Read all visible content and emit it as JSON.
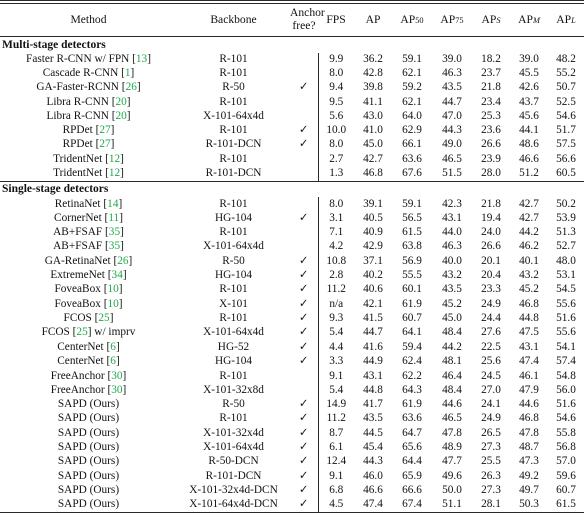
{
  "table": {
    "columns": [
      {
        "key": "method",
        "label": "Method"
      },
      {
        "key": "backbone",
        "label": "Backbone"
      },
      {
        "key": "anchor",
        "label": "Anchor free?",
        "label_line1": "Anchor",
        "label_line2": "free?"
      },
      {
        "key": "fps",
        "label": "FPS"
      },
      {
        "key": "ap",
        "label": "AP"
      },
      {
        "key": "ap50",
        "label": "AP50",
        "base": "AP",
        "sub": "50",
        "sub_italic": false
      },
      {
        "key": "ap75",
        "label": "AP75",
        "base": "AP",
        "sub": "75",
        "sub_italic": false
      },
      {
        "key": "aps",
        "label": "APS",
        "base": "AP",
        "sub": "S",
        "sub_italic": true
      },
      {
        "key": "apm",
        "label": "APM",
        "base": "AP",
        "sub": "M",
        "sub_italic": true
      },
      {
        "key": "apl",
        "label": "APL",
        "base": "AP",
        "sub": "L",
        "sub_italic": true
      }
    ],
    "check_glyph": "✓",
    "cite_color": "#1faa4b",
    "sections": [
      {
        "title": "Multi-stage detectors",
        "rows": [
          {
            "method": "Faster R-CNN w/ FPN",
            "cite": "13",
            "backbone": "R-101",
            "anchor": false,
            "fps": "9.9",
            "ap": "36.2",
            "ap50": "59.1",
            "ap75": "39.0",
            "aps": "18.2",
            "apm": "39.0",
            "apl": "48.2"
          },
          {
            "method": "Cascade R-CNN",
            "cite": "1",
            "backbone": "R-101",
            "anchor": false,
            "fps": "8.0",
            "ap": "42.8",
            "ap50": "62.1",
            "ap75": "46.3",
            "aps": "23.7",
            "apm": "45.5",
            "apl": "55.2"
          },
          {
            "method": "GA-Faster-RCNN",
            "cite": "26",
            "backbone": "R-50",
            "anchor": true,
            "fps": "9.4",
            "ap": "39.8",
            "ap50": "59.2",
            "ap75": "43.5",
            "aps": "21.8",
            "apm": "42.6",
            "apl": "50.7"
          },
          {
            "method": "Libra R-CNN",
            "cite": "20",
            "backbone": "R-101",
            "anchor": false,
            "fps": "9.5",
            "ap": "41.1",
            "ap50": "62.1",
            "ap75": "44.7",
            "aps": "23.4",
            "apm": "43.7",
            "apl": "52.5"
          },
          {
            "method": "Libra R-CNN",
            "cite": "20",
            "backbone": "X-101-64x4d",
            "anchor": false,
            "fps": "5.6",
            "ap": "43.0",
            "ap50": "64.0",
            "ap75": "47.0",
            "aps": "25.3",
            "apm": "45.6",
            "apl": "54.6"
          },
          {
            "method": "RPDet",
            "cite": "27",
            "backbone": "R-101",
            "anchor": true,
            "fps": "10.0",
            "ap": "41.0",
            "ap50": "62.9",
            "ap75": "44.3",
            "aps": "23.6",
            "apm": "44.1",
            "apl": "51.7"
          },
          {
            "method": "RPDet",
            "cite": "27",
            "backbone": "R-101-DCN",
            "anchor": true,
            "fps": "8.0",
            "ap": "45.0",
            "ap50": "66.1",
            "ap75": "49.0",
            "aps": "26.6",
            "apm": "48.6",
            "apl": "57.5"
          },
          {
            "method": "TridentNet",
            "cite": "12",
            "backbone": "R-101",
            "anchor": false,
            "fps": "2.7",
            "ap": "42.7",
            "ap50": "63.6",
            "ap75": "46.5",
            "aps": "23.9",
            "apm": "46.6",
            "apl": "56.6"
          },
          {
            "method": "TridentNet",
            "cite": "12",
            "backbone": "R-101-DCN",
            "anchor": false,
            "fps": "1.3",
            "ap": "46.8",
            "ap50": "67.6",
            "ap75": "51.5",
            "aps": "28.0",
            "apm": "51.2",
            "apl": "60.5"
          }
        ]
      },
      {
        "title": "Single-stage detectors",
        "rows": [
          {
            "method": "RetinaNet",
            "cite": "14",
            "backbone": "R-101",
            "anchor": false,
            "fps": "8.0",
            "ap": "39.1",
            "ap50": "59.1",
            "ap75": "42.3",
            "aps": "21.8",
            "apm": "42.7",
            "apl": "50.2"
          },
          {
            "method": "CornerNet",
            "cite": "11",
            "backbone": "HG-104",
            "anchor": true,
            "fps": "3.1",
            "ap": "40.5",
            "ap50": "56.5",
            "ap75": "43.1",
            "aps": "19.4",
            "apm": "42.7",
            "apl": "53.9"
          },
          {
            "method": "AB+FSAF",
            "cite": "35",
            "backbone": "R-101",
            "anchor": false,
            "fps": "7.1",
            "ap": "40.9",
            "ap50": "61.5",
            "ap75": "44.0",
            "aps": "24.0",
            "apm": "44.2",
            "apl": "51.3"
          },
          {
            "method": "AB+FSAF",
            "cite": "35",
            "backbone": "X-101-64x4d",
            "anchor": false,
            "fps": "4.2",
            "ap": "42.9",
            "ap50": "63.8",
            "ap75": "46.3",
            "aps": "26.6",
            "apm": "46.2",
            "apl": "52.7"
          },
          {
            "method": "GA-RetinaNet",
            "cite": "26",
            "backbone": "R-50",
            "anchor": true,
            "fps": "10.8",
            "ap": "37.1",
            "ap50": "56.9",
            "ap75": "40.0",
            "aps": "20.1",
            "apm": "40.1",
            "apl": "48.0"
          },
          {
            "method": "ExtremeNet",
            "cite": "34",
            "backbone": "HG-104",
            "anchor": true,
            "fps": "2.8",
            "ap": "40.2",
            "ap50": "55.5",
            "ap75": "43.2",
            "aps": "20.4",
            "apm": "43.2",
            "apl": "53.1"
          },
          {
            "method": "FoveaBox",
            "cite": "10",
            "backbone": "R-101",
            "anchor": true,
            "fps": "11.2",
            "ap": "40.6",
            "ap50": "60.1",
            "ap75": "43.5",
            "aps": "23.3",
            "apm": "45.2",
            "apl": "54.5"
          },
          {
            "method": "FoveaBox",
            "cite": "10",
            "backbone": "X-101",
            "anchor": true,
            "fps": "n/a",
            "ap": "42.1",
            "ap50": "61.9",
            "ap75": "45.2",
            "aps": "24.9",
            "apm": "46.8",
            "apl": "55.6"
          },
          {
            "method": "FCOS",
            "cite": "25",
            "backbone": "R-101",
            "anchor": true,
            "fps": "9.3",
            "ap": "41.5",
            "ap50": "60.7",
            "ap75": "45.0",
            "aps": "24.4",
            "apm": "44.8",
            "apl": "51.6"
          },
          {
            "method": "FCOS",
            "cite": "25",
            "method_suffix": " w/ imprv",
            "backbone": "X-101-64x4d",
            "anchor": true,
            "fps": "5.4",
            "ap": "44.7",
            "ap50": "64.1",
            "ap75": "48.4",
            "aps": "27.6",
            "apm": "47.5",
            "apl": "55.6"
          },
          {
            "method": "CenterNet",
            "cite": "6",
            "backbone": "HG-52",
            "anchor": true,
            "fps": "4.4",
            "ap": "41.6",
            "ap50": "59.4",
            "ap75": "44.2",
            "aps": "22.5",
            "apm": "43.1",
            "apl": "54.1"
          },
          {
            "method": "CenterNet",
            "cite": "6",
            "backbone": "HG-104",
            "anchor": true,
            "fps": "3.3",
            "ap": "44.9",
            "ap50": "62.4",
            "ap75": "48.1",
            "aps": "25.6",
            "apm": "47.4",
            "apl": "57.4"
          },
          {
            "method": "FreeAnchor",
            "cite": "30",
            "backbone": "R-101",
            "anchor": false,
            "fps": "9.1",
            "ap": "43.1",
            "ap50": "62.2",
            "ap75": "46.4",
            "aps": "24.5",
            "apm": "46.1",
            "apl": "54.8"
          },
          {
            "method": "FreeAnchor",
            "cite": "30",
            "backbone": "X-101-32x8d",
            "anchor": false,
            "fps": "5.4",
            "ap": "44.8",
            "ap50": "64.3",
            "ap75": "48.4",
            "aps": "27.0",
            "apm": "47.9",
            "apl": "56.0"
          },
          {
            "method": "SAPD (Ours)",
            "cite": "",
            "backbone": "R-50",
            "anchor": true,
            "fps": "14.9",
            "ap": "41.7",
            "ap50": "61.9",
            "ap75": "44.6",
            "aps": "24.1",
            "apm": "44.6",
            "apl": "51.6"
          },
          {
            "method": "SAPD (Ours)",
            "cite": "",
            "backbone": "R-101",
            "anchor": true,
            "fps": "11.2",
            "ap": "43.5",
            "ap50": "63.6",
            "ap75": "46.5",
            "aps": "24.9",
            "apm": "46.8",
            "apl": "54.6"
          },
          {
            "method": "SAPD (Ours)",
            "cite": "",
            "backbone": "X-101-32x4d",
            "anchor": true,
            "fps": "8.7",
            "ap": "44.5",
            "ap50": "64.7",
            "ap75": "47.8",
            "aps": "26.5",
            "apm": "47.8",
            "apl": "55.8"
          },
          {
            "method": "SAPD (Ours)",
            "cite": "",
            "backbone": "X-101-64x4d",
            "anchor": true,
            "fps": "6.1",
            "ap": "45.4",
            "ap50": "65.6",
            "ap75": "48.9",
            "aps": "27.3",
            "apm": "48.7",
            "apl": "56.8"
          },
          {
            "method": "SAPD (Ours)",
            "cite": "",
            "backbone": "R-50-DCN",
            "anchor": true,
            "fps": "12.4",
            "ap": "44.3",
            "ap50": "64.4",
            "ap75": "47.7",
            "aps": "25.5",
            "apm": "47.3",
            "apl": "57.0"
          },
          {
            "method": "SAPD (Ours)",
            "cite": "",
            "backbone": "R-101-DCN",
            "anchor": true,
            "fps": "9.1",
            "ap": "46.0",
            "ap50": "65.9",
            "ap75": "49.6",
            "aps": "26.3",
            "apm": "49.2",
            "apl": "59.6"
          },
          {
            "method": "SAPD (Ours)",
            "cite": "",
            "backbone": "X-101-32x4d-DCN",
            "anchor": true,
            "fps": "6.8",
            "ap": "46.6",
            "ap50": "66.6",
            "ap75": "50.0",
            "aps": "27.3",
            "apm": "49.7",
            "apl": "60.7"
          },
          {
            "method": "SAPD (Ours)",
            "cite": "",
            "backbone": "X-101-64x4d-DCN",
            "anchor": true,
            "fps": "4.5",
            "ap": "47.4",
            "ap50": "67.4",
            "ap75": "51.1",
            "aps": "28.1",
            "apm": "50.3",
            "apl": "61.5"
          }
        ]
      }
    ]
  }
}
